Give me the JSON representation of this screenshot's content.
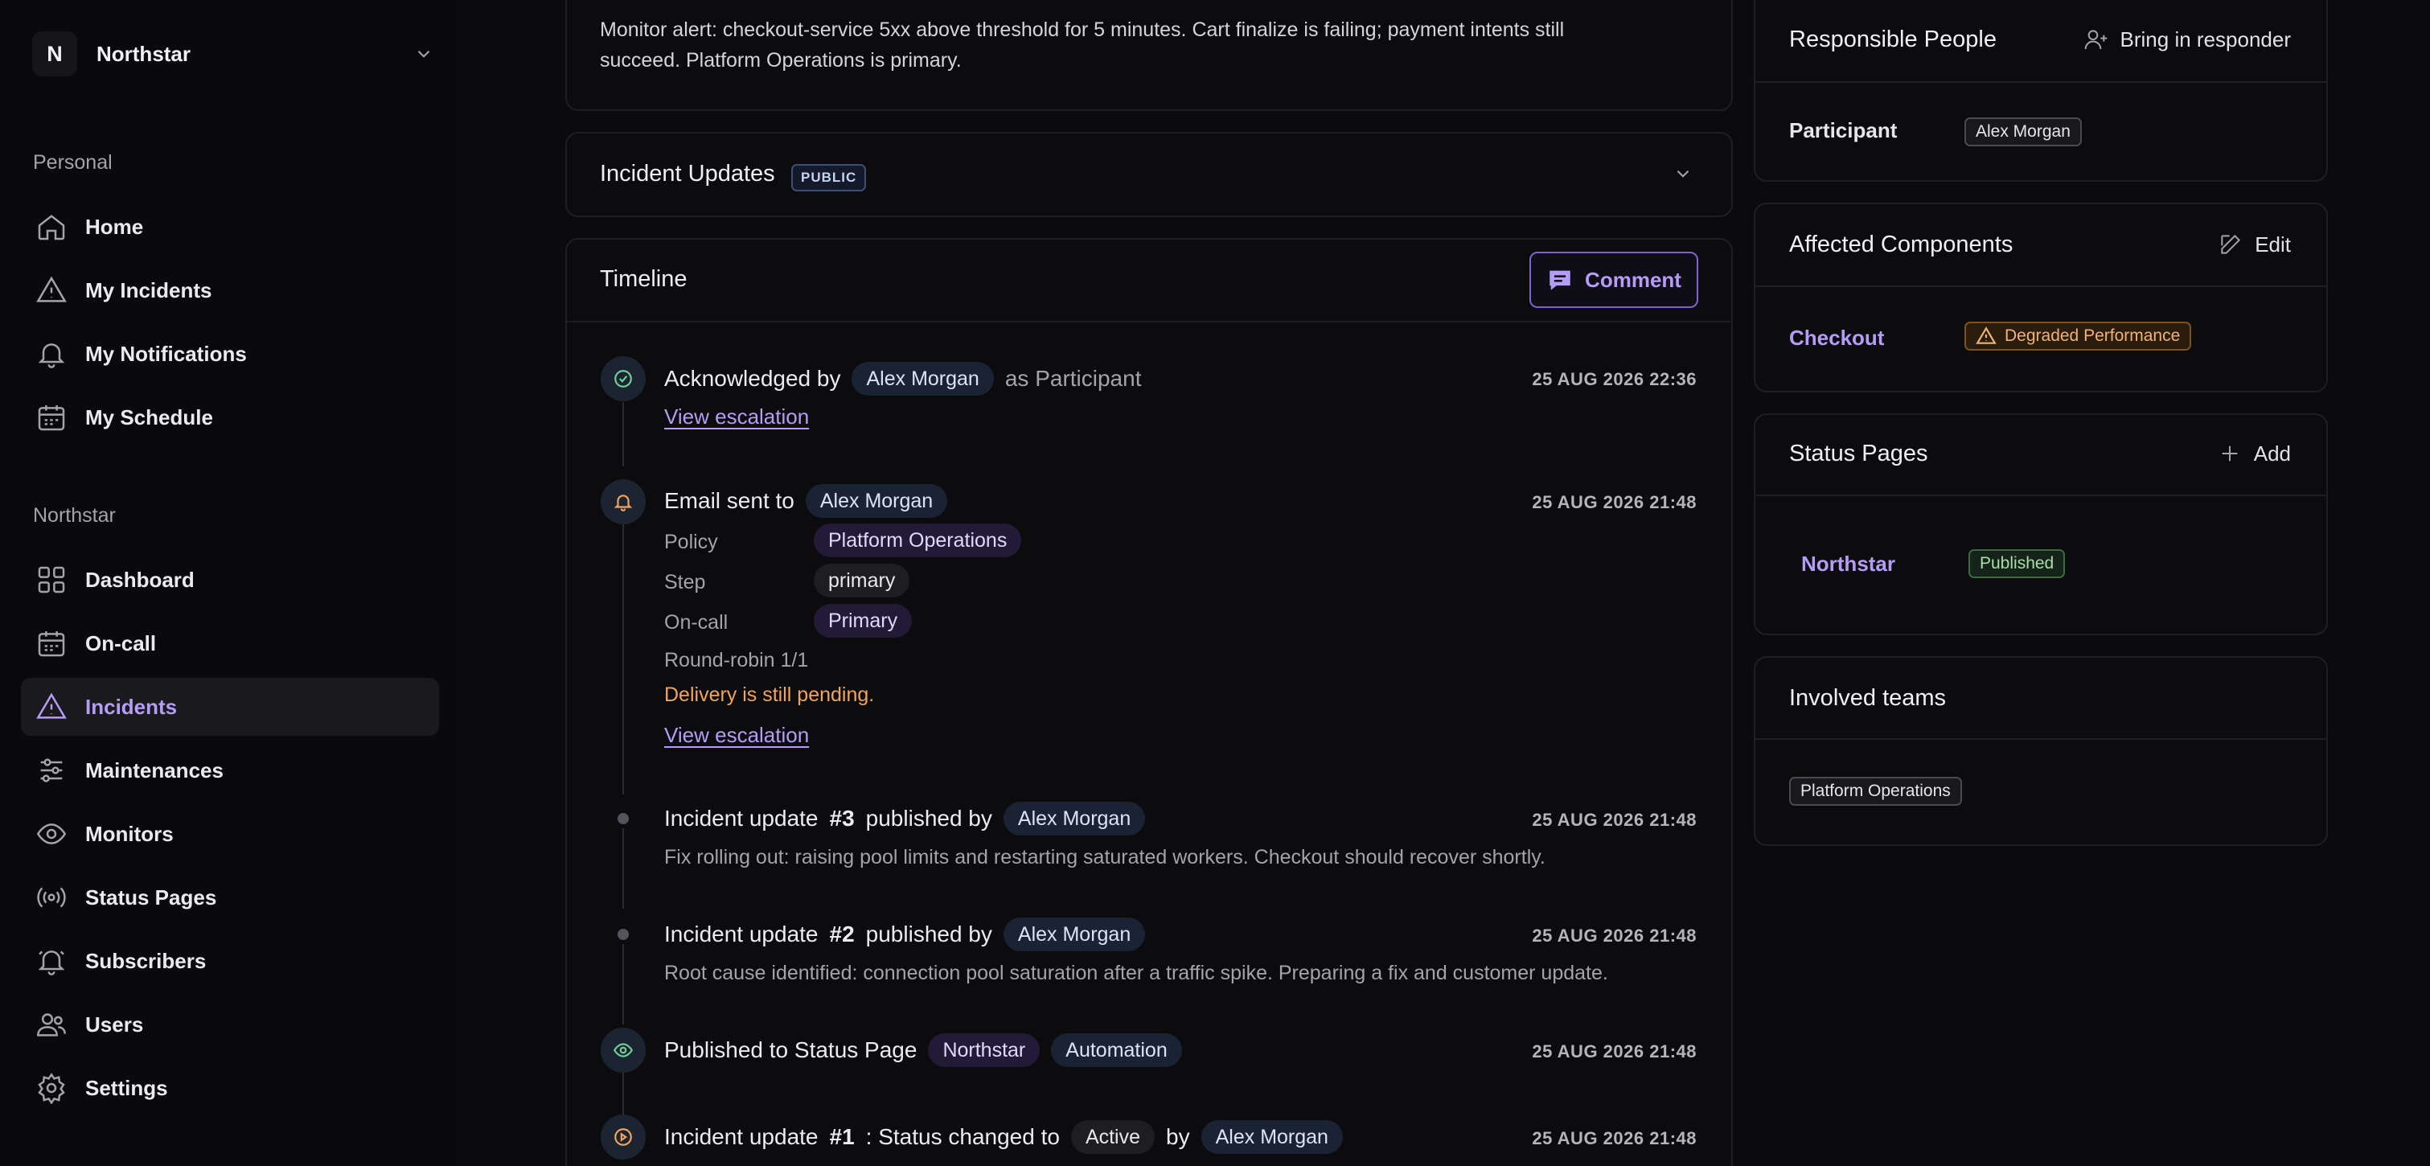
{
  "org": {
    "initial": "N",
    "name": "Northstar"
  },
  "sidebar": {
    "personal_label": "Personal",
    "personal_items": [
      {
        "label": "Home",
        "icon": "home-icon"
      },
      {
        "label": "My Incidents",
        "icon": "alert-icon"
      },
      {
        "label": "My Notifications",
        "icon": "bell-icon"
      },
      {
        "label": "My Schedule",
        "icon": "calendar-icon"
      }
    ],
    "org_label": "Northstar",
    "org_items": [
      {
        "label": "Dashboard",
        "icon": "grid-icon"
      },
      {
        "label": "On-call",
        "icon": "calendar-icon"
      },
      {
        "label": "Incidents",
        "icon": "alert-icon",
        "active": true
      },
      {
        "label": "Maintenances",
        "icon": "sliders-icon"
      },
      {
        "label": "Monitors",
        "icon": "eye-icon"
      },
      {
        "label": "Status Pages",
        "icon": "broadcast-icon"
      },
      {
        "label": "Subscribers",
        "icon": "bell-ring-icon"
      },
      {
        "label": "Users",
        "icon": "users-icon"
      },
      {
        "label": "Settings",
        "icon": "gear-icon"
      }
    ]
  },
  "description": {
    "text": "Monitor alert: checkout-service 5xx above threshold for 5 minutes. Cart finalize is failing; payment intents still succeed. Platform Operations is primary."
  },
  "incident_updates": {
    "title": "Incident Updates",
    "badge": "PUBLIC"
  },
  "timeline": {
    "title": "Timeline",
    "comment_label": "Comment",
    "ack": {
      "prefix": "Acknowledged by",
      "person": "Alex Morgan",
      "suffix": "as Participant",
      "time": "25 AUG 2026 22:36",
      "link": "View escalation"
    },
    "email": {
      "prefix": "Email sent to",
      "person": "Alex Morgan",
      "time": "25 AUG 2026 21:48",
      "policy_key": "Policy",
      "policy_val": "Platform Operations",
      "step_key": "Step",
      "step_val": "primary",
      "oncall_key": "On-call",
      "oncall_val": "Primary",
      "roundrobin": "Round-robin 1/1",
      "pending": "Delivery is still pending.",
      "link": "View escalation"
    },
    "update3": {
      "prefix": "Incident update",
      "num": "#3",
      "mid": "published by",
      "person": "Alex Morgan",
      "time": "25 AUG 2026 21:48",
      "text": "Fix rolling out: raising pool limits and restarting saturated workers. Checkout should recover shortly."
    },
    "update2": {
      "prefix": "Incident update",
      "num": "#2",
      "mid": "published by",
      "person": "Alex Morgan",
      "time": "25 AUG 2026 21:48",
      "text": "Root cause identified: connection pool saturation after a traffic spike. Preparing a fix and customer update."
    },
    "published": {
      "prefix": "Published to Status Page",
      "page": "Northstar",
      "actor": "Automation",
      "time": "25 AUG 2026 21:48"
    },
    "update1": {
      "prefix": "Incident update",
      "num": "#1",
      "mid": ": Status changed to",
      "status": "Active",
      "by": "by",
      "person": "Alex Morgan",
      "time": "25 AUG 2026 21:48"
    }
  },
  "responsible": {
    "title": "Responsible People",
    "action": "Bring in responder",
    "role": "Participant",
    "person": "Alex Morgan"
  },
  "components": {
    "title": "Affected Components",
    "action": "Edit",
    "name": "Checkout",
    "status": "Degraded Performance"
  },
  "status_pages": {
    "title": "Status Pages",
    "action": "Add",
    "name": "Northstar",
    "status": "Published"
  },
  "teams": {
    "title": "Involved teams",
    "team": "Platform Operations"
  },
  "colors": {
    "accent": "#b59cf7",
    "warning": "#f2a45c",
    "success": "#a9dfa5"
  }
}
